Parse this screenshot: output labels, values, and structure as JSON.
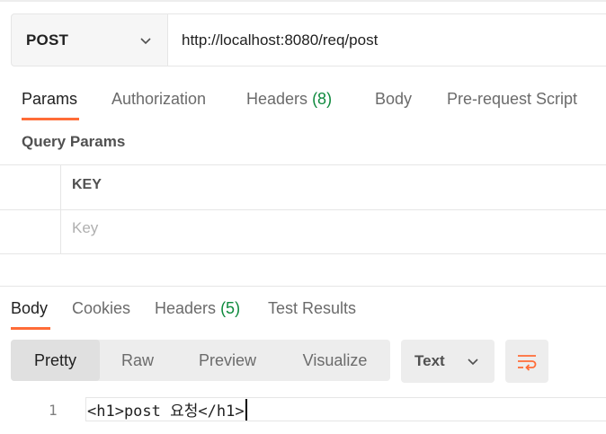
{
  "request": {
    "method": "POST",
    "url": "http://localhost:8080/req/post"
  },
  "request_tabs": [
    {
      "label": "Params",
      "active": true
    },
    {
      "label": "Authorization"
    },
    {
      "label": "Headers",
      "count": "(8)"
    },
    {
      "label": "Body"
    },
    {
      "label": "Pre-request Script"
    }
  ],
  "query_params": {
    "title": "Query Params",
    "key_header": "KEY",
    "key_placeholder": "Key"
  },
  "response_tabs": [
    {
      "label": "Body",
      "active": true
    },
    {
      "label": "Cookies"
    },
    {
      "label": "Headers",
      "count": "(5)"
    },
    {
      "label": "Test Results"
    }
  ],
  "format_modes": [
    "Pretty",
    "Raw",
    "Preview",
    "Visualize"
  ],
  "active_format": "Pretty",
  "language": "Text",
  "response_body": {
    "line_number": "1",
    "code": "<h1>post 요청</h1>"
  },
  "colors": {
    "accent": "#ff6c37",
    "count_green": "#0f8a3e"
  },
  "icons": {
    "method_dropdown": "chevron-down-icon",
    "language_dropdown": "chevron-down-icon",
    "wrap": "word-wrap-icon"
  }
}
